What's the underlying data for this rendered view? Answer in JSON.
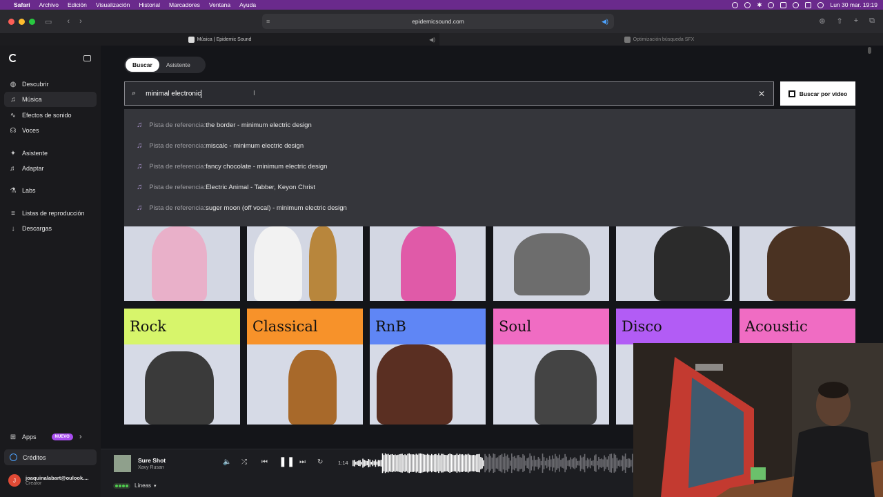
{
  "menubar": {
    "app": "Safari",
    "items": [
      "Archivo",
      "Edición",
      "Visualización",
      "Historial",
      "Marcadores",
      "Ventana",
      "Ayuda"
    ],
    "clock": "Lun 30 mar.  19:19"
  },
  "browser": {
    "url": "epidemicsound.com",
    "tabs": [
      {
        "title": "Música | Epidemic Sound"
      },
      {
        "title": "Optimización búsqueda SFX"
      }
    ]
  },
  "sidebar": {
    "items": [
      {
        "label": "Descubrir",
        "icon": "globe-icon"
      },
      {
        "label": "Música",
        "icon": "music-note-icon"
      },
      {
        "label": "Efectos de sonido",
        "icon": "waveform-icon"
      },
      {
        "label": "Voces",
        "icon": "voice-icon"
      },
      {
        "label": "Asistente",
        "icon": "sparkle-icon"
      },
      {
        "label": "Adaptar",
        "icon": "adapt-icon"
      },
      {
        "label": "Labs",
        "icon": "flask-icon"
      },
      {
        "label": "Listas de reproducción",
        "icon": "playlist-icon"
      },
      {
        "label": "Descargas",
        "icon": "download-icon"
      }
    ],
    "apps_label": "Apps",
    "apps_badge": "NUEVO",
    "credits_label": "Créditos",
    "user_email": "joaquinalabart@oulook....",
    "user_plan": "Creator",
    "user_initial": "J"
  },
  "search": {
    "mode_search": "Buscar",
    "mode_assistant": "Asistente",
    "query": "minimal electronic",
    "video_button": "Buscar por video",
    "suggestion_prefix": "Pista de referencia:",
    "suggestions": [
      " the border - minimum electric design",
      " miscalc - minimum electric design",
      " fancy chocolate - minimum electric design",
      " Electric Animal - Tabber, Keyon Christ",
      " suger moon (off vocal) - minimum electric design"
    ]
  },
  "genres": [
    {
      "name": "Rock",
      "color": "#d7f56b"
    },
    {
      "name": "Classical",
      "color": "#f7922a"
    },
    {
      "name": "RnB",
      "color": "#5f86f5"
    },
    {
      "name": "Soul",
      "color": "#f06cc3"
    },
    {
      "name": "Disco",
      "color": "#b25cf5"
    },
    {
      "name": "Acoustic",
      "color": "#f06cc3"
    }
  ],
  "player": {
    "title": "Sure Shot",
    "artist": "Xavy Rusan",
    "time": "1:14",
    "stems_label": "Líneas",
    "progress": 0.47
  }
}
